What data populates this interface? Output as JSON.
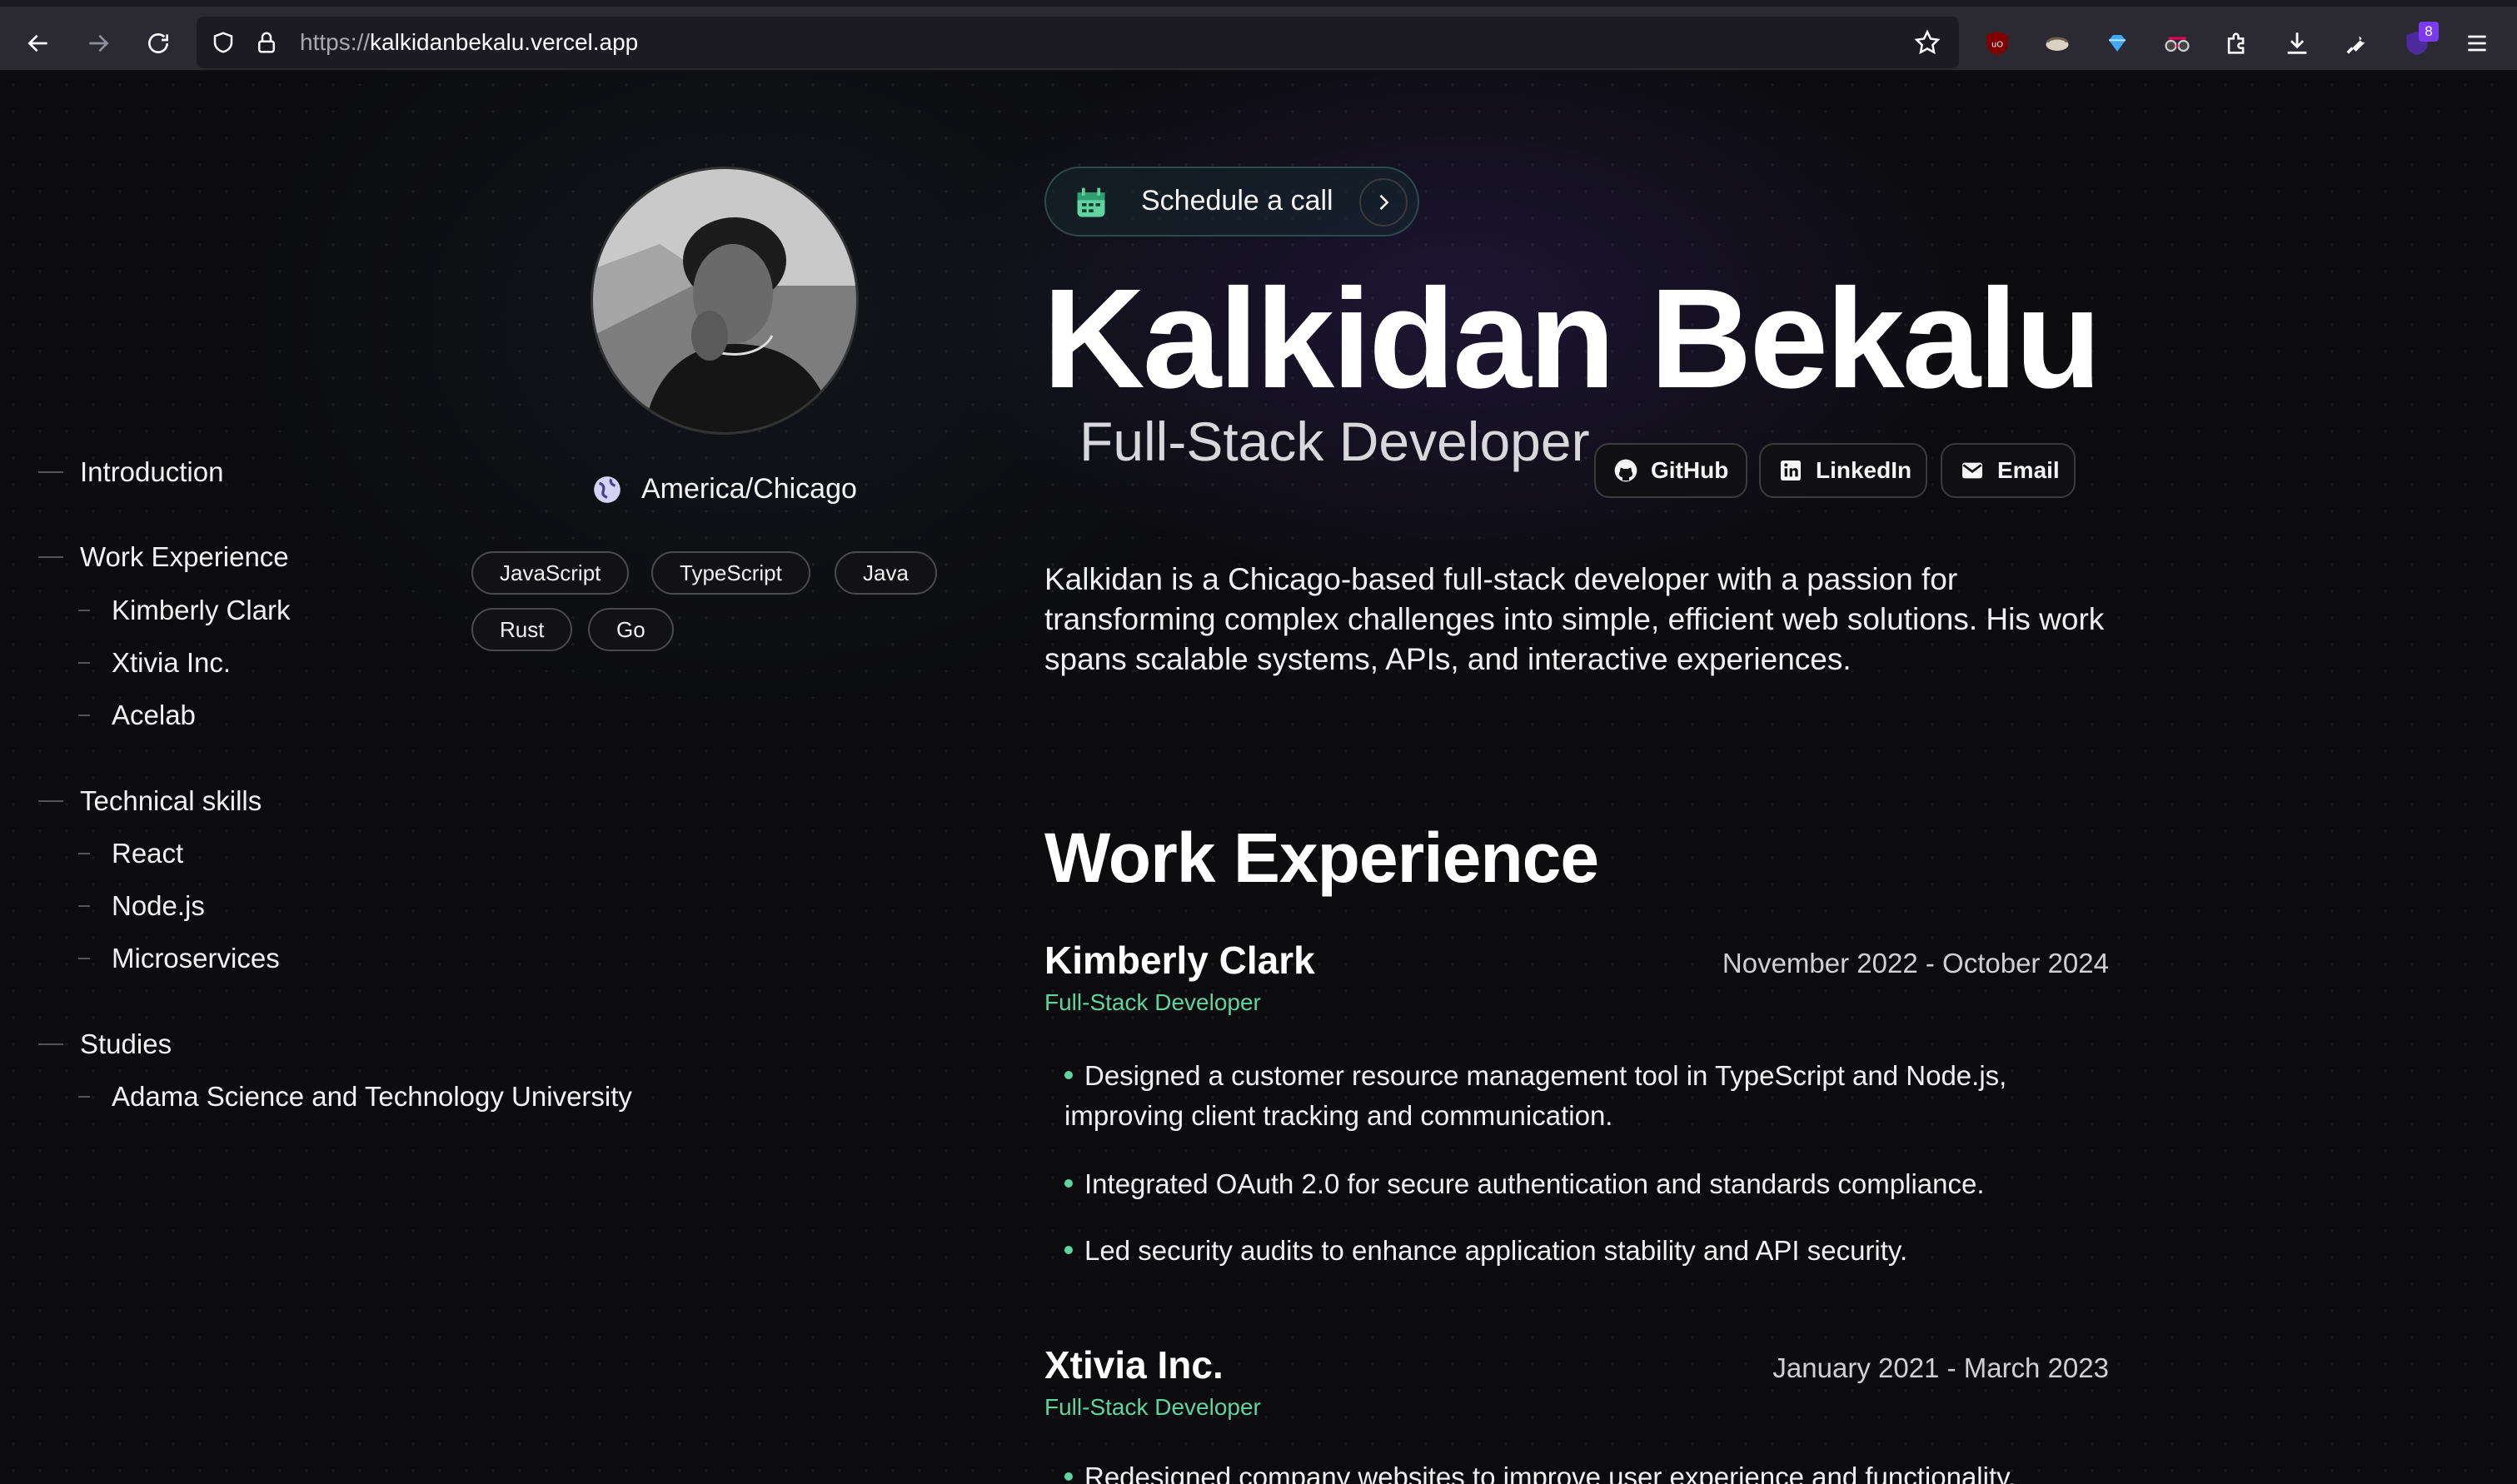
{
  "browser": {
    "url_scheme": "https://",
    "url_host": "kalkidanbekalu.vercel.app",
    "extension_badge": "8"
  },
  "toc": {
    "items": [
      {
        "label": "Introduction",
        "level": 0
      },
      {
        "label": "Work Experience",
        "level": 0
      },
      {
        "label": "Kimberly Clark",
        "level": 1
      },
      {
        "label": "Xtivia Inc.",
        "level": 1
      },
      {
        "label": "Acelab",
        "level": 1
      },
      {
        "label": "Technical skills",
        "level": 0
      },
      {
        "label": "React",
        "level": 1
      },
      {
        "label": "Node.js",
        "level": 1
      },
      {
        "label": "Microservices",
        "level": 1
      },
      {
        "label": "Studies",
        "level": 0
      },
      {
        "label": "Adama Science and Technology University",
        "level": 1
      }
    ]
  },
  "profile": {
    "location": "America/Chicago",
    "tags": [
      "JavaScript",
      "TypeScript",
      "Java",
      "Rust",
      "Go"
    ]
  },
  "header": {
    "schedule_label": "Schedule a call",
    "name": "Kalkidan Bekalu",
    "role": "Full-Stack Developer",
    "social": {
      "github": "GitHub",
      "linkedin": "LinkedIn",
      "email": "Email"
    },
    "bio": "Kalkidan is a Chicago-based full-stack developer with a passion for transforming complex challenges into simple, efficient web solutions. His work spans scalable systems, APIs, and interactive experiences."
  },
  "work": {
    "title": "Work Experience",
    "jobs": [
      {
        "company": "Kimberly Clark",
        "dates": "November 2022 - October 2024",
        "role": "Full-Stack Developer",
        "bullets": [
          "Designed a customer resource management tool in TypeScript and Node.js, improving client tracking and communication.",
          "Integrated OAuth 2.0 for secure authentication and standards compliance.",
          "Led security audits to enhance application stability and API security."
        ]
      },
      {
        "company": "Xtivia Inc.",
        "dates": "January 2021 - March 2023",
        "role": "Full-Stack Developer",
        "bullets": [
          "Redesigned company websites to improve user experience and functionality."
        ]
      }
    ]
  },
  "colors": {
    "accent": "#5fd4a0",
    "background": "#0c0c0f"
  }
}
